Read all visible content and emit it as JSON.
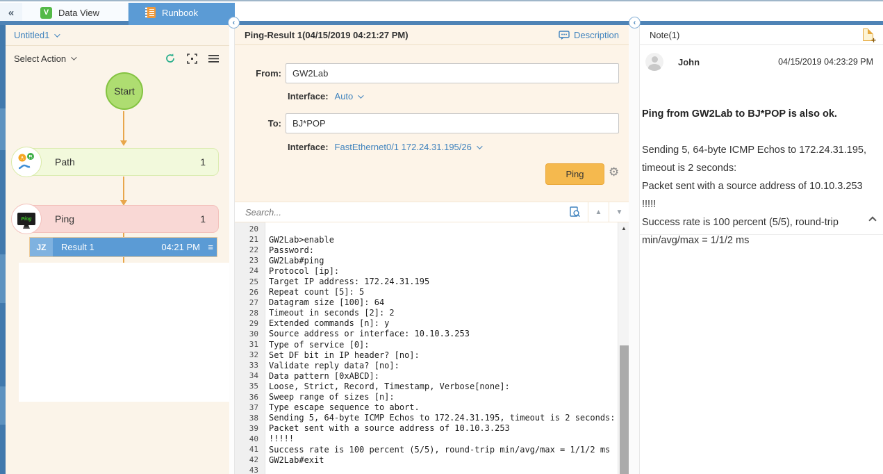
{
  "colors": {
    "accent_blue": "#5b9bd5",
    "link_blue": "#3e82bd",
    "cream_bg": "#fdf4e8",
    "arrow_orange": "#e8a64b",
    "ping_button_orange": "#f5b94e",
    "start_green": "#aedd71",
    "path_node_green": "#f2f9dc",
    "ping_node_pink": "#f9d8d5",
    "result_blue": "#5b9bd5"
  },
  "topbar": {
    "collapse_glyph": "«",
    "tabs": [
      {
        "label": "Data View",
        "icon": "data-view-icon",
        "icon_letter": "V",
        "active": false
      },
      {
        "label": "Runbook",
        "icon": "runbook-icon",
        "active": true
      }
    ]
  },
  "runbook_panel": {
    "title": "Untitled1",
    "select_action_label": "Select Action",
    "flow": {
      "start_label": "Start",
      "path_node": {
        "label": "Path",
        "count": "1"
      },
      "ping_node": {
        "label": "Ping",
        "count": "1",
        "icon_label": "Ping"
      },
      "result_item": {
        "badge": "JZ",
        "label": "Result 1",
        "time": "04:21 PM",
        "menu_glyph": "≡"
      }
    }
  },
  "result_panel": {
    "title": "Ping-Result 1(04/15/2019 04:21:27 PM)",
    "description_label": "Description",
    "form": {
      "from_label": "From:",
      "from_value": "GW2Lab",
      "from_interface_label": "Interface:",
      "from_interface_value": "Auto",
      "to_label": "To:",
      "to_value": "BJ*POP",
      "to_interface_label": "Interface:",
      "to_interface_value": "FastEthernet0/1 172.24.31.195/26",
      "ping_button_label": "Ping"
    },
    "search_placeholder": "Search...",
    "console": {
      "lines": [
        {
          "n": "20",
          "text": ""
        },
        {
          "n": "21",
          "text": "GW2Lab>enable"
        },
        {
          "n": "22",
          "text": "Password:"
        },
        {
          "n": "23",
          "text": "GW2Lab#ping"
        },
        {
          "n": "24",
          "text": "Protocol [ip]:"
        },
        {
          "n": "25",
          "text": "Target IP address: 172.24.31.195"
        },
        {
          "n": "26",
          "text": "Repeat count [5]: 5"
        },
        {
          "n": "27",
          "text": "Datagram size [100]: 64"
        },
        {
          "n": "28",
          "text": "Timeout in seconds [2]: 2"
        },
        {
          "n": "29",
          "text": "Extended commands [n]: y"
        },
        {
          "n": "30",
          "text": "Source address or interface: 10.10.3.253"
        },
        {
          "n": "31",
          "text": "Type of service [0]:"
        },
        {
          "n": "32",
          "text": "Set DF bit in IP header? [no]:"
        },
        {
          "n": "33",
          "text": "Validate reply data? [no]:"
        },
        {
          "n": "34",
          "text": "Data pattern [0xABCD]:"
        },
        {
          "n": "35",
          "text": "Loose, Strict, Record, Timestamp, Verbose[none]:"
        },
        {
          "n": "36",
          "text": "Sweep range of sizes [n]:"
        },
        {
          "n": "37",
          "text": "Type escape sequence to abort."
        },
        {
          "n": "38",
          "text": "Sending 5, 64-byte ICMP Echos to 172.24.31.195, timeout is 2 seconds:"
        },
        {
          "n": "39",
          "text": "Packet sent with a source address of 10.10.3.253"
        },
        {
          "n": "40",
          "text": "!!!!!"
        },
        {
          "n": "41",
          "text": "Success rate is 100 percent (5/5), round-trip min/avg/max = 1/1/2 ms"
        },
        {
          "n": "42",
          "text": "GW2Lab#exit"
        },
        {
          "n": "43",
          "text": ""
        }
      ]
    }
  },
  "note_panel": {
    "title": "Note(1)",
    "author": "John",
    "timestamp": "04/15/2019 04:23:29 PM",
    "summary": "Ping from GW2Lab to BJ*POP is also ok.",
    "body_lines": [
      "Sending 5, 64-byte ICMP Echos to 172.24.31.195, timeout is 2 seconds:",
      "Packet sent with a source address of 10.10.3.253",
      "!!!!!",
      "Success rate is 100 percent (5/5), round-trip min/avg/max = 1/1/2 ms"
    ]
  }
}
